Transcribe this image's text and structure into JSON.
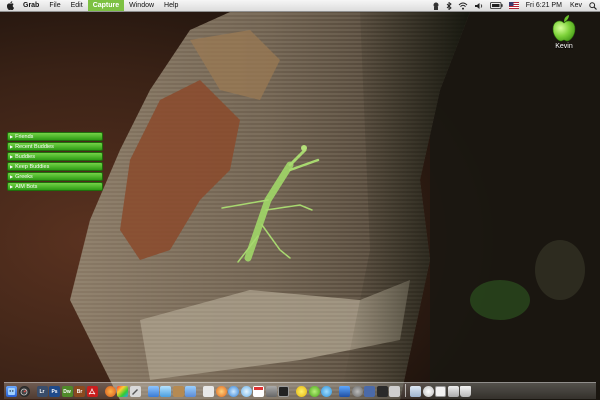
{
  "menubar": {
    "apple_icon": "apple-icon",
    "app_name": "Grab",
    "items": [
      "File",
      "Edit",
      "Capture",
      "Window",
      "Help"
    ],
    "active_item": "Capture",
    "status_icons": [
      "grab-status-icon",
      "bluetooth-icon",
      "wifi-icon",
      "volume-icon",
      "battery-icon",
      "input-flag-icon"
    ],
    "clock": "Fri 6:21 PM",
    "user": "Kev",
    "spotlight_icon": "spotlight-icon",
    "accent_color": "#7dc142"
  },
  "desktop": {
    "icon_label": "Kevin",
    "icon_name": "green-apple-drive-icon"
  },
  "buddy_list": {
    "groups": [
      "Friends",
      "Recent Buddies",
      "Buddies",
      "Keep Buddies",
      "Greeks",
      "AIM Bots"
    ],
    "color": "#3aaa1e"
  },
  "dock": {
    "labels": [
      "Lr",
      "Ps",
      "Dw",
      "Br"
    ]
  }
}
